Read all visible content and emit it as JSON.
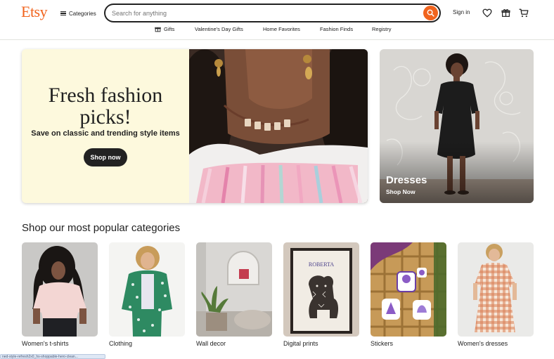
{
  "brand": {
    "logo": "Etsy",
    "accent": "#f1641e"
  },
  "header": {
    "categories_label": "Categories",
    "search": {
      "placeholder": "Search for anything",
      "value": ""
    },
    "signin_label": "Sign in",
    "icons": [
      "heart-icon",
      "gift-icon",
      "cart-icon"
    ]
  },
  "nav": {
    "items": [
      {
        "label": "Gifts",
        "icon": "gift-icon"
      },
      {
        "label": "Valentine's Day Gifts"
      },
      {
        "label": "Home Favorites"
      },
      {
        "label": "Fashion Finds"
      },
      {
        "label": "Registry"
      }
    ]
  },
  "hero": {
    "main": {
      "title_line1": "Fresh fashion",
      "title_line2": "picks!",
      "subtitle": "Save on classic and trending style items",
      "cta": "Shop now"
    },
    "side": {
      "title": "Dresses",
      "link": "Shop Now"
    }
  },
  "popular": {
    "title": "Shop our most popular categories",
    "items": [
      {
        "label": "Women's t-shirts"
      },
      {
        "label": "Clothing"
      },
      {
        "label": "Wall decor"
      },
      {
        "label": "Digital prints"
      },
      {
        "label": "Stickers"
      },
      {
        "label": "Women's dresses"
      }
    ]
  },
  "status_bar": {
    "text": "ned-style-refresh2x0_hs-shoppable-hero-clean..."
  }
}
